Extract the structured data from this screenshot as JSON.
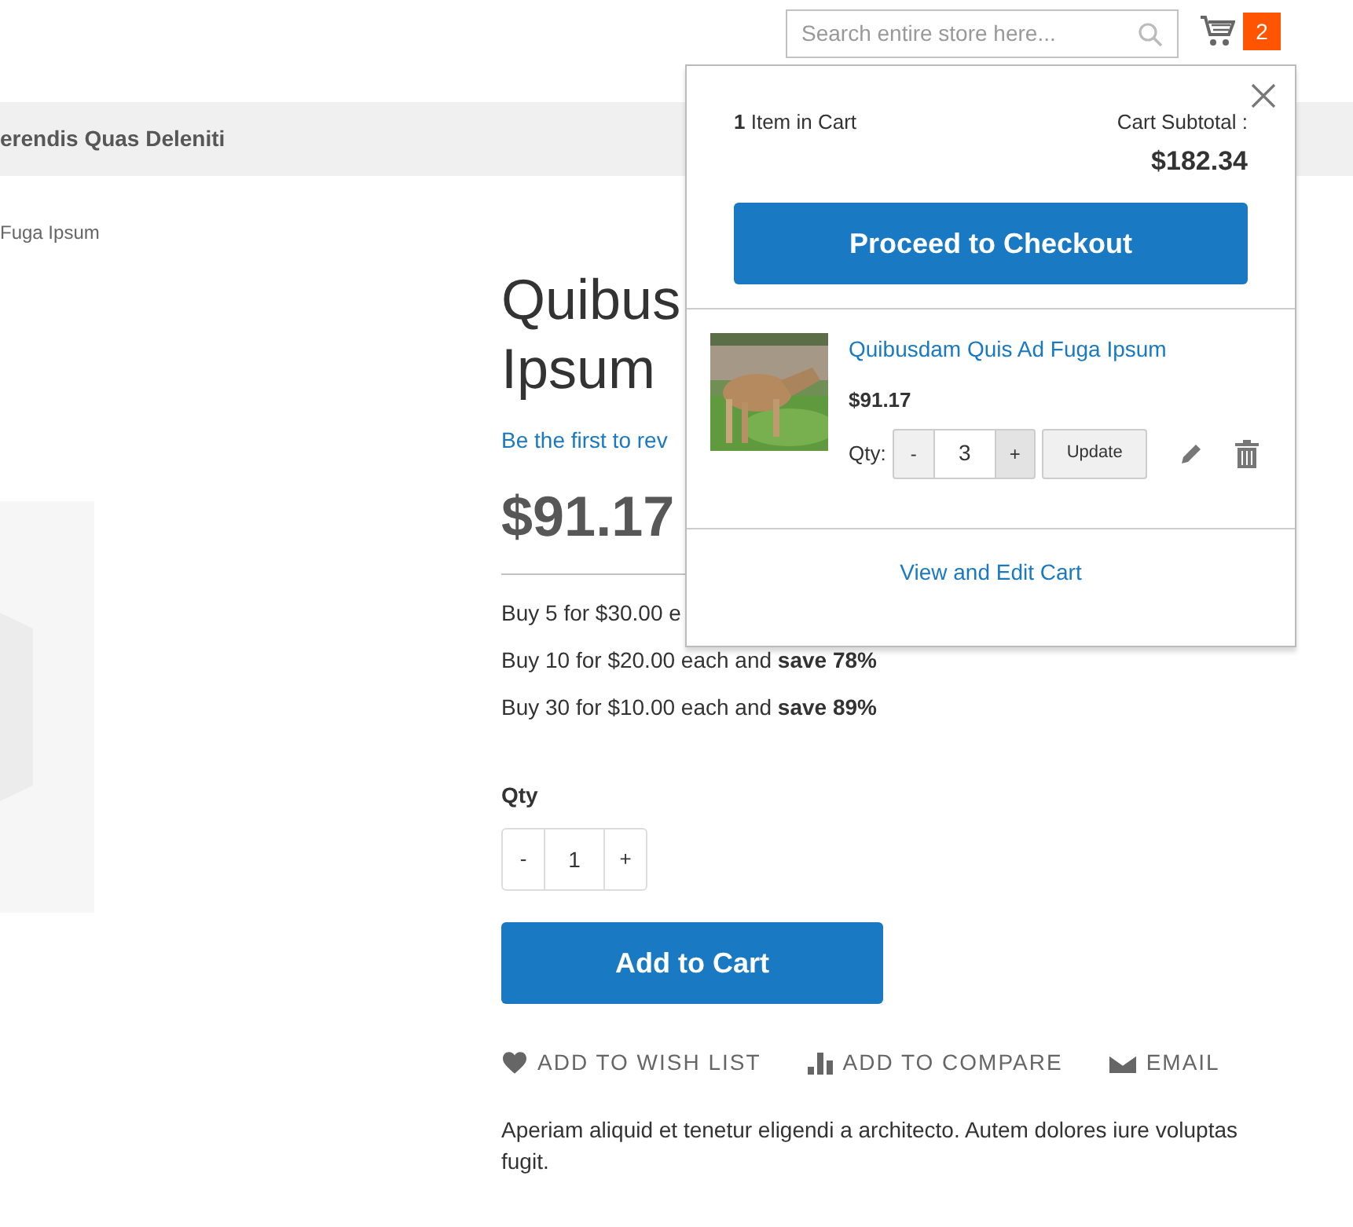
{
  "header": {
    "search": {
      "placeholder": "Search entire store here..."
    },
    "cart_count": "2"
  },
  "nav": {
    "label": "erendis Quas Deleniti"
  },
  "breadcrumb": "Fuga Ipsum",
  "product": {
    "title_lines": [
      "Quibus",
      "Ipsum"
    ],
    "review_link": "Be the first to rev",
    "price": "$91.17",
    "tier_prices": [
      "Buy 5 for $30.00 e",
      "Buy 10 for $20.00 each and **save 78%**",
      "Buy 30 for $10.00 each and **save 89%**"
    ],
    "qty_label": "Qty",
    "qty": {
      "minus": "-",
      "value": "1",
      "plus": "+"
    },
    "add_to_cart": "Add to Cart",
    "actions": [
      {
        "kind": "wishlist",
        "label": "ADD TO WISH LIST"
      },
      {
        "kind": "compare",
        "label": "ADD TO COMPARE"
      },
      {
        "kind": "email",
        "label": "EMAIL"
      }
    ],
    "description": "Aperiam aliquid et tenetur eligendi a architecto. Autem dolores iure voluptas fugit."
  },
  "minicart": {
    "count_text": "**1** Item in Cart",
    "subtotal_label": "Cart Subtotal :",
    "subtotal": "$182.34",
    "checkout": "Proceed to Checkout",
    "items": [
      {
        "kind": "picture",
        "name": "Quibusdam Quis Ad Fuga Ipsum",
        "price": "$91.17",
        "qty_label": "Qty:",
        "minus": "-",
        "qty": "3",
        "plus": "+",
        "update": "Update"
      }
    ],
    "view_edit": "View and Edit Cart"
  }
}
